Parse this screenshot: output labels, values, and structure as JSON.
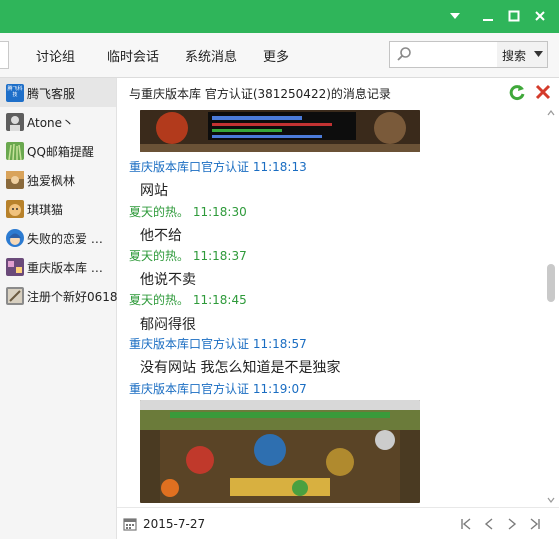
{
  "toolbar": {
    "tabs": [
      "讨论组",
      "临时会话",
      "系统消息",
      "更多"
    ],
    "search_placeholder": "",
    "search_button": "搜索"
  },
  "contacts": [
    {
      "name": "腾飞客服",
      "avatar_text": "腾飞科技",
      "color": "#1e6fc9"
    },
    {
      "name": "Atone丶",
      "color": "#5e5e5e"
    },
    {
      "name": "QQ邮箱提醒",
      "color": "#6aa84f"
    },
    {
      "name": "独爱枫林",
      "color": "#8a6a3c"
    },
    {
      "name": "琪琪猫",
      "color": "#b8822b"
    },
    {
      "name": "失败的恋爱 …",
      "color": "#2c7bd1"
    },
    {
      "name": "重庆版本库 …",
      "color": "#6b4b7a"
    },
    {
      "name": "注册个新好0618",
      "color": "#8b8b8b"
    }
  ],
  "chat": {
    "header": "与重庆版本库  官方认证(381250422)的消息记录",
    "messages": [
      {
        "sender": "重庆版本库口官方认证",
        "time": "11:18:13",
        "color": "blue"
      },
      {
        "text": "网站"
      },
      {
        "sender": "夏天的热。",
        "time": "11:18:30",
        "color": "green"
      },
      {
        "text": "他不给"
      },
      {
        "sender": "夏天的热。",
        "time": "11:18:37",
        "color": "green"
      },
      {
        "text": "他说不卖"
      },
      {
        "sender": "夏天的热。",
        "time": "11:18:45",
        "color": "green"
      },
      {
        "text": "郁闷得很"
      },
      {
        "sender": "重庆版本库口官方认证",
        "time": "11:18:57",
        "color": "blue"
      },
      {
        "text": "没有网站 我怎么知道是不是独家"
      },
      {
        "sender": "重庆版本库口官方认证",
        "time": "11:19:07",
        "color": "blue"
      }
    ]
  },
  "footer": {
    "date": "2015-7-27"
  },
  "colors": {
    "titlebar": "#2fb55a",
    "blue_sender": "#1a6dc2",
    "green_sender": "#2e9a3a"
  }
}
